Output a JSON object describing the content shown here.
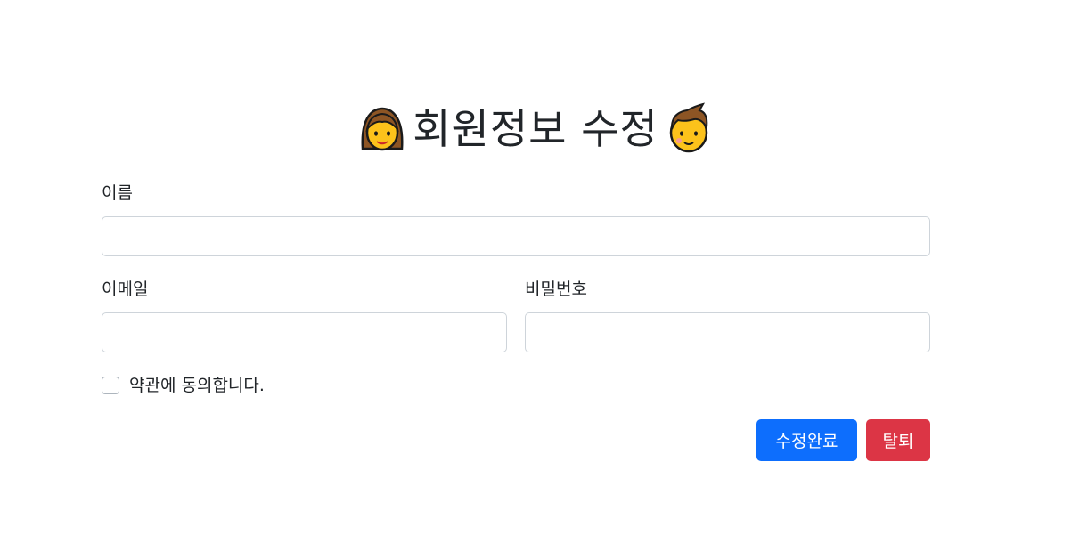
{
  "header": {
    "title": "회원정보 수정",
    "left_icon": "woman-emoji-icon",
    "right_icon": "man-emoji-icon"
  },
  "form": {
    "name_label": "이름",
    "name_value": "",
    "email_label": "이메일",
    "email_value": "",
    "password_label": "비밀번호",
    "password_value": "",
    "agree_label": "약관에 동의합니다.",
    "agree_checked": false
  },
  "actions": {
    "submit_label": "수정완료",
    "withdraw_label": "탈퇴"
  },
  "colors": {
    "primary": "#0d6efd",
    "danger": "#dc3545",
    "input_border": "#ced4da",
    "text": "#212529"
  }
}
